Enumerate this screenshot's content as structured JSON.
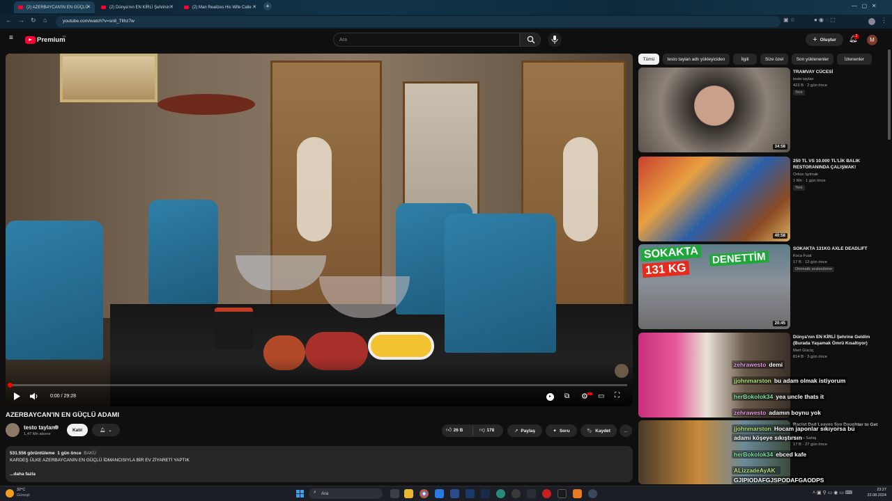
{
  "browser": {
    "tabs": [
      {
        "label": "(2) AZERBAYCAN'IN EN GÜÇLÜ",
        "active": true
      },
      {
        "label": "(2) Dünya'nın EN KİRLİ Şehrinin",
        "active": false
      },
      {
        "label": "(2) Man Realizes His Wife Calle",
        "active": false
      }
    ],
    "new_tab": "+",
    "url": "youtube.com/watch?v=sn8_Tllhz7w"
  },
  "header": {
    "logo": "Premium",
    "logo_sup": "TR",
    "search_placeholder": "Ara",
    "create_label": "Oluştur",
    "notif_count": "2",
    "avatar": "M"
  },
  "player": {
    "time": "0:00 / 29:28",
    "progress": 0.0
  },
  "video": {
    "title": "AZERBAYCAN'IN EN GÜÇLÜ ADAMI",
    "channel": "testo taylan",
    "subs": "1,47 Mn abone",
    "join_label": "Katıl",
    "likes": "26 B",
    "dislikes": "178",
    "share": "Paylaş",
    "ask": "Soru",
    "save": "Kaydet",
    "more": "..."
  },
  "description": {
    "views": "531.556 görüntüleme",
    "age": "1 gün önce",
    "location": "BAKÜ",
    "text": "KARDEŞ ÜLKE AZERBAYCANIN EN GÜÇLÜ İDMANCISIYLA BİR EV ZİYARETİ YAPTIK",
    "more": "...daha fazla"
  },
  "chips": [
    "Tümü",
    "testo taylan adlı yükleyiciden",
    "İlgili",
    "Size özel",
    "Son yüklenenler",
    "İzlenenler"
  ],
  "recommendations": [
    {
      "title": "TRAMVAY CÜCESİ",
      "channel": "testo taylan",
      "meta": "422 B · 2 gün önce",
      "badge": "Yeni",
      "duration": "34:58"
    },
    {
      "title": "250 TL VS 10.000 TL'LİK BALIK RESTORANINDA ÇALIŞMAK!",
      "channel": "Orkun Işıtmak",
      "meta": "1 Mn · 1 gün önce",
      "badge": "Yeni",
      "duration": "40:58"
    },
    {
      "title": "SOKAKTA 131KG AXLE DEADLIFT",
      "channel": "Koca Fuat",
      "meta": "17 B · 12 gün önce",
      "badge": "Otomatik seslendirme",
      "duration": "20:45",
      "thumb_text_1": "SOKAKTA",
      "thumb_text_2": "131 KG",
      "thumb_text_3": "DENETTİM"
    },
    {
      "title": "Dünya'nın EN KİRLİ Şehrine Geldim (Burada Yaşamak Ömrü Kısaltıyor)",
      "channel": "Mert Gücüç",
      "meta": "814 B · 3 gün önce",
      "badge": "",
      "duration": ""
    },
    {
      "title": "Racist Dad Leaves 5yo Daughter to Get",
      "channel": "Rahim Sahiq",
      "meta": "17 B · 27 gün önce",
      "badge": "",
      "duration": ""
    }
  ],
  "chat": [
    {
      "user": "zehrawesto",
      "msg": "demi",
      "color": "#e79ce8"
    },
    {
      "user": "jjohnmarston",
      "msg": "bu adam olmak istiyorum",
      "color": "#b6e67a"
    },
    {
      "user": "herBokolok34",
      "msg": "yea uncle thats it",
      "color": "#7de9a6"
    },
    {
      "user": "zehrawesto",
      "msg": "adamın boynu yok",
      "color": "#e79ce8"
    },
    {
      "user": "jjohnmarston",
      "msg": "Hocam japonlar sıkıyorsa bu",
      "color": "#b6e67a"
    },
    {
      "user": "",
      "msg": "adamı köşeye sıkıştırsın",
      "color": "#ffffff"
    },
    {
      "user": "herBokolok34",
      "msg": "ebced kafe",
      "color": "#7de9a6"
    },
    {
      "user": "ALizzadeAyAK",
      "msg": "",
      "color": "#b6e67a"
    },
    {
      "user": "",
      "msg": "GJIPIODAFGJSPODAFGAODPS",
      "color": "#ffffff"
    }
  ],
  "taskbar": {
    "weather_temp": "32°C",
    "weather_desc": "Güneşli",
    "search": "Ara",
    "time": "23:27",
    "date": "22.08.2024"
  }
}
